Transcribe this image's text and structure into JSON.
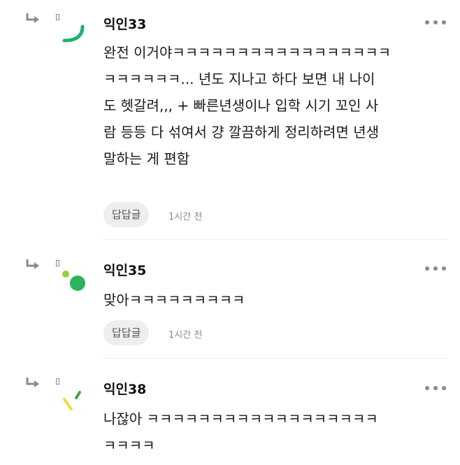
{
  "comments": [
    {
      "nickname": "익인33",
      "text": "완전 이거야ㅋㅋㅋㅋㅋㅋㅋㅋㅋㅋㅋㅋㅋㅋㅋㅋㅋ\nㅋㅋㅋㅋㅋㅋ... 년도 지나고 하다 보면 내 나이\n도 헷갈려,,, + 빠른년생이나 입학 시기 꼬인 사\n람 등등 다 섞여서 걍 깔끔하게 정리하려면 년생\n말하는 게 편함",
      "reply_label": "답답글",
      "time": "1시간 전",
      "avatar_color": "#1fb36b"
    },
    {
      "nickname": "익인35",
      "text": "맞아ㅋㅋㅋㅋㅋㅋㅋㅋㅋ",
      "reply_label": "답답글",
      "time": "1시간 전",
      "avatar_color": "#2cb45c"
    },
    {
      "nickname": "익인38",
      "text": "나잖아 ㅋㅋㅋㅋㅋㅋㅋㅋㅋㅋㅋㅋㅋㅋㅋㅋㅋㅋ\nㅋㅋㅋㅋ",
      "avatar_color": "#8fd43a"
    }
  ],
  "icons": {
    "reply": "reply-arrow-icon",
    "more": "more-options-icon"
  },
  "colors": {
    "icon_gray": "#8a8a8a",
    "button_bg": "#eeeeee",
    "divider": "#ececec"
  }
}
